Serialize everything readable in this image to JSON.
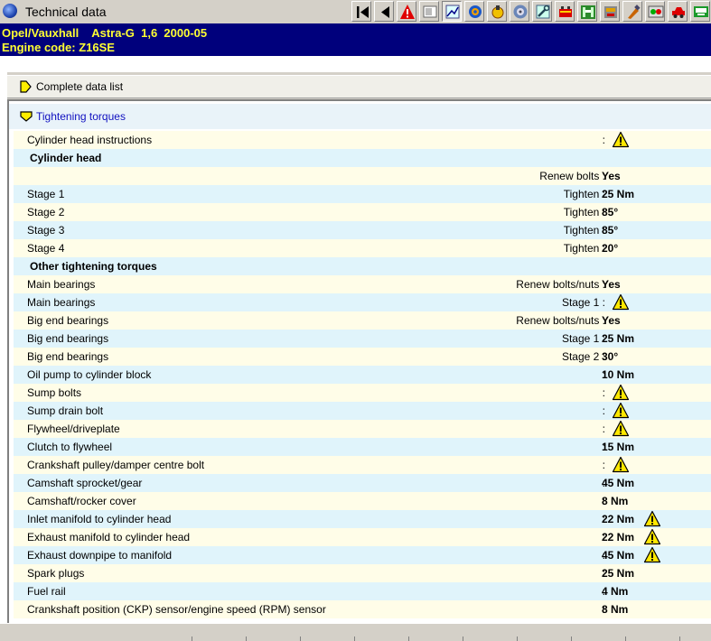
{
  "window": {
    "title": "Technical data"
  },
  "toolbar": {
    "buttons": [
      {
        "name": "first-page-button",
        "icon": "skip-first-icon"
      },
      {
        "name": "back-button",
        "icon": "triangle-left-icon"
      },
      {
        "name": "warnings-button",
        "icon": "warning-icon"
      },
      {
        "name": "document-button",
        "icon": "document-icon"
      },
      {
        "name": "technical-data-button",
        "icon": "chart-icon"
      },
      {
        "name": "engine-button",
        "icon": "gear-icon"
      },
      {
        "name": "ignition-button",
        "icon": "ignition-icon"
      },
      {
        "name": "wheel-button",
        "icon": "wheel-icon"
      },
      {
        "name": "adjustment-button",
        "icon": "wrench-icon"
      },
      {
        "name": "battery-button",
        "icon": "battery-icon"
      },
      {
        "name": "lift-button",
        "icon": "lift-icon"
      },
      {
        "name": "fuel-button",
        "icon": "fuel-icon"
      },
      {
        "name": "paint-button",
        "icon": "brush-icon"
      },
      {
        "name": "dashboard-button",
        "icon": "dashboard-icon"
      },
      {
        "name": "car-button",
        "icon": "car-icon"
      },
      {
        "name": "bus-button",
        "icon": "bus-icon"
      },
      {
        "name": "settings-button",
        "icon": "settings-icon"
      }
    ]
  },
  "vehicle": {
    "model_line": "Opel/Vauxhall    Astra-G  1,6  2000-05",
    "engine_line": "Engine code: Z16SE"
  },
  "sections": {
    "complete": "Complete data list",
    "tightening": "Tightening torques"
  },
  "rows": [
    {
      "type": "item",
      "name": "Cylinder head instructions",
      "qual": ":",
      "val": "",
      "warn1": true,
      "warn2": false
    },
    {
      "type": "header",
      "name": "Cylinder head"
    },
    {
      "type": "item",
      "name": "",
      "qual": "Renew bolts :",
      "val": "Yes",
      "warn1": false,
      "warn2": false
    },
    {
      "type": "item",
      "name": "Stage 1",
      "qual": "Tighten :",
      "val": "25 Nm",
      "warn1": false,
      "warn2": false
    },
    {
      "type": "item",
      "name": "Stage 2",
      "qual": "Tighten :",
      "val": "85°",
      "warn1": false,
      "warn2": false
    },
    {
      "type": "item",
      "name": "Stage 3",
      "qual": "Tighten :",
      "val": "85°",
      "warn1": false,
      "warn2": false
    },
    {
      "type": "item",
      "name": "Stage 4",
      "qual": "Tighten :",
      "val": "20°",
      "warn1": false,
      "warn2": false
    },
    {
      "type": "header",
      "name": "Other tightening torques"
    },
    {
      "type": "item",
      "name": "Main bearings",
      "qual": "Renew bolts/nuts :",
      "val": "Yes",
      "warn1": false,
      "warn2": false
    },
    {
      "type": "item",
      "name": "Main bearings",
      "qual": "Stage 1 :",
      "val": "",
      "warn1": true,
      "warn2": false
    },
    {
      "type": "item",
      "name": "Big end bearings",
      "qual": "Renew bolts/nuts :",
      "val": "Yes",
      "warn1": false,
      "warn2": false
    },
    {
      "type": "item",
      "name": "Big end bearings",
      "qual": "Stage 1 :",
      "val": "25 Nm",
      "warn1": false,
      "warn2": false
    },
    {
      "type": "item",
      "name": "Big end bearings",
      "qual": "Stage 2 :",
      "val": "30°",
      "warn1": false,
      "warn2": false
    },
    {
      "type": "item",
      "name": "Oil pump to cylinder block",
      "qual": ":",
      "val": "10 Nm",
      "warn1": false,
      "warn2": false
    },
    {
      "type": "item",
      "name": "Sump bolts",
      "qual": ":",
      "val": "",
      "warn1": true,
      "warn2": false
    },
    {
      "type": "item",
      "name": "Sump drain bolt",
      "qual": ":",
      "val": "",
      "warn1": true,
      "warn2": false
    },
    {
      "type": "item",
      "name": "Flywheel/driveplate",
      "qual": ":",
      "val": "",
      "warn1": true,
      "warn2": false
    },
    {
      "type": "item",
      "name": "Clutch to flywheel",
      "qual": ":",
      "val": "15 Nm",
      "warn1": false,
      "warn2": false
    },
    {
      "type": "item",
      "name": "Crankshaft pulley/damper centre bolt",
      "qual": ":",
      "val": "",
      "warn1": true,
      "warn2": false
    },
    {
      "type": "item",
      "name": "Camshaft sprocket/gear",
      "qual": ":",
      "val": "45 Nm",
      "warn1": false,
      "warn2": false
    },
    {
      "type": "item",
      "name": "Camshaft/rocker cover",
      "qual": ":",
      "val": "8 Nm",
      "warn1": false,
      "warn2": false
    },
    {
      "type": "item",
      "name": "Inlet manifold to cylinder head",
      "qual": ":",
      "val": "22 Nm",
      "warn1": false,
      "warn2": true
    },
    {
      "type": "item",
      "name": "Exhaust manifold to cylinder head",
      "qual": ":",
      "val": "22 Nm",
      "warn1": false,
      "warn2": true
    },
    {
      "type": "item",
      "name": "Exhaust downpipe to manifold",
      "qual": ":",
      "val": "45 Nm",
      "warn1": false,
      "warn2": true
    },
    {
      "type": "item",
      "name": "Spark plugs",
      "qual": ":",
      "val": "25 Nm",
      "warn1": false,
      "warn2": false
    },
    {
      "type": "item",
      "name": "Fuel rail",
      "qual": ":",
      "val": "4 Nm",
      "warn1": false,
      "warn2": false
    },
    {
      "type": "item",
      "name": "Crankshaft position (CKP) sensor/engine speed (RPM) sensor",
      "qual": ":",
      "val": "8 Nm",
      "warn1": false,
      "warn2": false
    }
  ],
  "colors": {
    "vehicle_bg": "#00007c",
    "vehicle_text": "#ffff33",
    "row_odd": "#fffde8",
    "row_even": "#e0f4fb",
    "section_link": "#1010c0",
    "warning_fill": "#ffe800"
  }
}
